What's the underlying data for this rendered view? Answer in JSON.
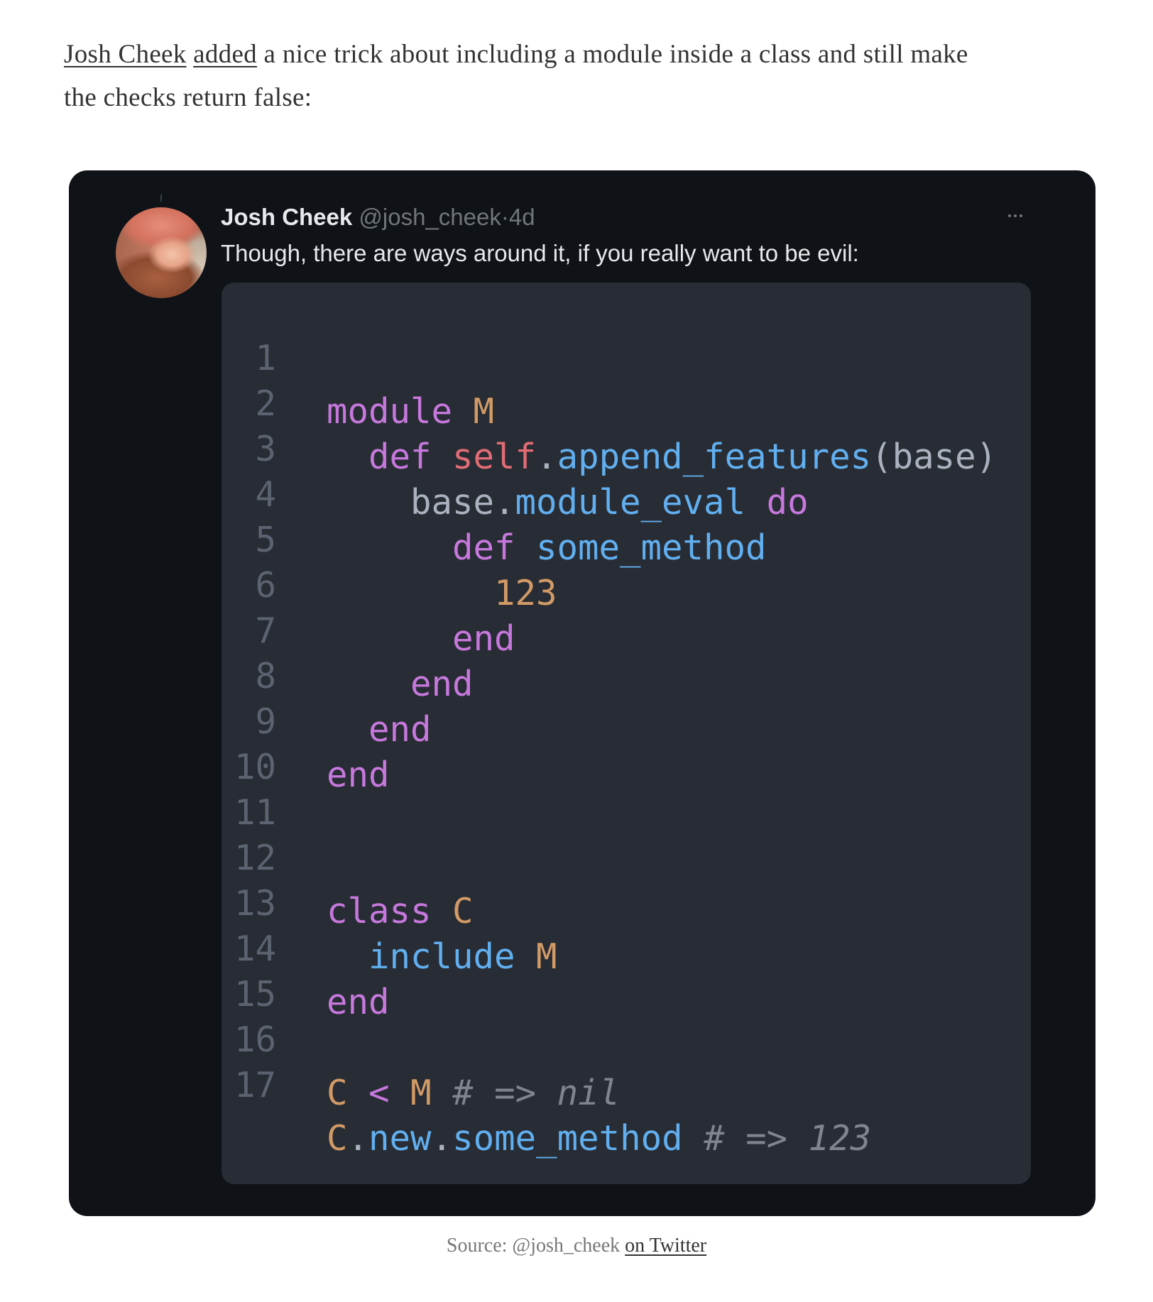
{
  "intro": {
    "link_author": "Josh Cheek",
    "link_added": "added",
    "text_rest_1": " a nice trick about including a module inside a class and still make",
    "text_rest_2": "the checks return false:"
  },
  "tweet": {
    "name": "Josh Cheek",
    "handle": "@josh_cheek",
    "separator": "·",
    "time": "4d",
    "text": "Though, there are ways around it, if you really want to be evil:",
    "more_icon": "more-horizontal-icon",
    "avatar_icon": "avatar-photo"
  },
  "code": {
    "line_numbers": [
      "1",
      "2",
      "3",
      "4",
      "5",
      "6",
      "7",
      "8",
      "9",
      "10",
      "11",
      "12",
      "13",
      "14",
      "15",
      "16",
      "17"
    ],
    "l1": {
      "kw": "module",
      "name": "M"
    },
    "l2": {
      "kw": "def",
      "self": "self",
      "dot": ".",
      "fn": "append_features",
      "args": "(base)"
    },
    "l3": {
      "recv": "base",
      "dot": ".",
      "fn": "module_eval",
      "kw": "do"
    },
    "l4": {
      "kw": "def",
      "fn": "some_method"
    },
    "l5": {
      "num": "123"
    },
    "l6": {
      "kw": "end"
    },
    "l7": {
      "kw": "end"
    },
    "l8": {
      "kw": "end"
    },
    "l9": {
      "kw": "end"
    },
    "l12": {
      "kw": "class",
      "name": "C"
    },
    "l13": {
      "fn": "include",
      "name": "M"
    },
    "l14": {
      "kw": "end"
    },
    "l16": {
      "c": "C",
      "op": "<",
      "m": "M",
      "comment": "# => nil"
    },
    "l17": {
      "c": "C",
      "dot1": ".",
      "new": "new",
      "dot2": ".",
      "fn": "some_method",
      "comment": "# => 123"
    }
  },
  "caption": {
    "prefix": "Source: @josh_cheek ",
    "link": "on Twitter"
  }
}
